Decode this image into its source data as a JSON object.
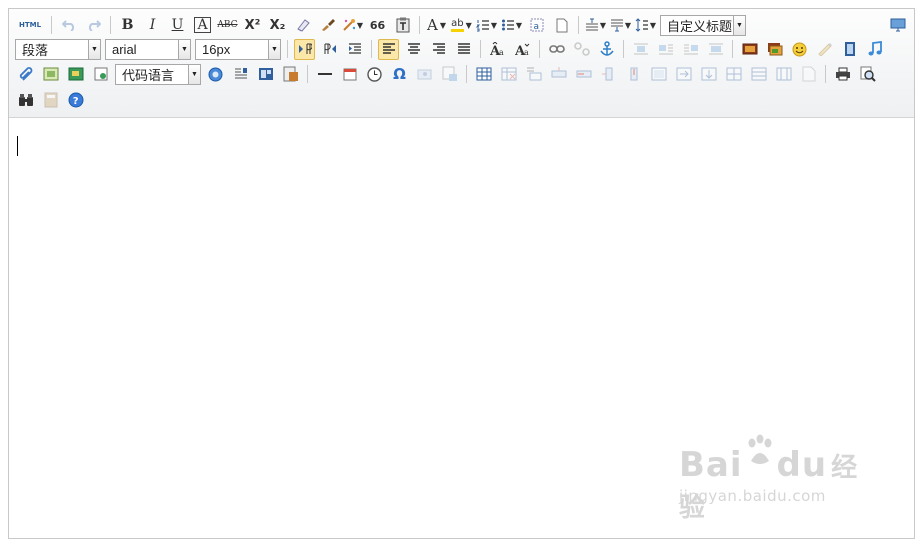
{
  "toolbar": {
    "source_label": "HTML",
    "bold": "B",
    "italic": "I",
    "underline": "U",
    "fontborder": "A",
    "strikethrough": "ABC",
    "superscript": "X²",
    "subscript": "X₂",
    "quote": "66",
    "forecolor": "A",
    "backcolor": "ab",
    "formula": "Ω",
    "paragraph_select": "段落",
    "fontfamily_select": "arial",
    "fontsize_select": "16px",
    "custom_title_select": "自定义标题",
    "code_lang_select": "代码语言"
  },
  "watermark": {
    "logo_left": "Bai",
    "logo_right": "du",
    "logo_cn": "经验",
    "url": "jingyan.baidu.com"
  },
  "colors": {
    "accent": "#2f5f9c",
    "active_bg": "#fbe7a8",
    "toolbar_bg": "#eef0f2"
  }
}
